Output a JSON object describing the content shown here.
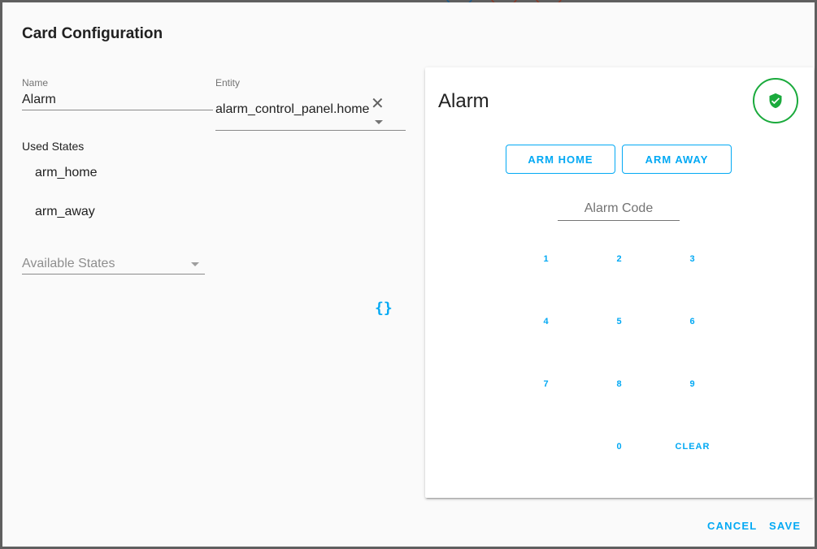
{
  "dialog": {
    "title": "Card Configuration",
    "name_field": {
      "label": "Name",
      "value": "Alarm"
    },
    "entity_field": {
      "label": "Entity",
      "value": "alarm_control_panel.home",
      "clear_icon": "close-icon",
      "dropdown_icon": "arrow-drop-down-icon"
    },
    "used_states": {
      "label": "Used States",
      "items": [
        "arm_home",
        "arm_away"
      ]
    },
    "available_states": {
      "placeholder": "Available States",
      "dropdown_icon": "arrow-drop-down-icon"
    },
    "code_editor_toggle": {
      "label": "{}",
      "icon": "code-braces-icon"
    },
    "actions": {
      "cancel": "CANCEL",
      "save": "SAVE"
    }
  },
  "preview_card": {
    "title": "Alarm",
    "state_icon": "shield-check-icon",
    "state_color": "#1aaa3c",
    "accent_color": "#03a9f4",
    "buttons": [
      "ARM HOME",
      "ARM AWAY"
    ],
    "code_input": {
      "placeholder": "Alarm Code",
      "value": ""
    },
    "keypad": [
      "1",
      "2",
      "3",
      "4",
      "5",
      "6",
      "7",
      "8",
      "9",
      "0",
      "CLEAR"
    ]
  }
}
